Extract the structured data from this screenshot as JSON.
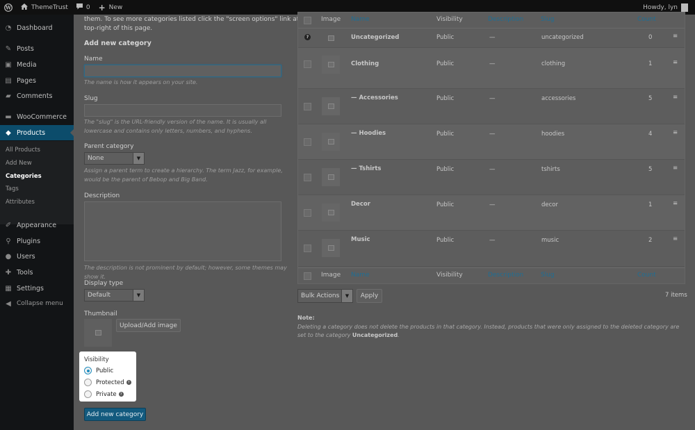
{
  "adminbar": {
    "site_name": "ThemeTrust",
    "comments_count": "0",
    "new_label": "New",
    "howdy": "Howdy, lyn"
  },
  "sidebar": {
    "items": [
      {
        "label": "Dashboard",
        "icon": "dashboard-icon"
      },
      {
        "label": "Posts",
        "icon": "pin-icon"
      },
      {
        "label": "Media",
        "icon": "media-icon"
      },
      {
        "label": "Pages",
        "icon": "pages-icon"
      },
      {
        "label": "Comments",
        "icon": "comment-icon"
      },
      {
        "label": "WooCommerce",
        "icon": "woocommerce-icon"
      },
      {
        "label": "Products",
        "icon": "products-icon"
      },
      {
        "label": "Appearance",
        "icon": "brush-icon"
      },
      {
        "label": "Plugins",
        "icon": "plug-icon"
      },
      {
        "label": "Users",
        "icon": "users-icon"
      },
      {
        "label": "Tools",
        "icon": "wrench-icon"
      },
      {
        "label": "Settings",
        "icon": "settings-icon"
      },
      {
        "label": "Collapse menu",
        "icon": "collapse-icon"
      }
    ],
    "submenu": [
      "All Products",
      "Add New",
      "Categories",
      "Tags",
      "Attributes"
    ]
  },
  "form": {
    "intro_line1": "them. To see more categories listed click the \"screen options\" link at the",
    "intro_line2": "top-right of this page.",
    "heading": "Add new category",
    "name_label": "Name",
    "name_help": "The name is how it appears on your site.",
    "slug_label": "Slug",
    "slug_help": "The \"slug\" is the URL-friendly version of the name. It is usually all lowercase and contains only letters, numbers, and hyphens.",
    "parent_label": "Parent category",
    "parent_value": "None",
    "parent_help": "Assign a parent term to create a hierarchy. The term Jazz, for example, would be the parent of Bebop and Big Band.",
    "description_label": "Description",
    "description_help": "The description is not prominent by default; however, some themes may show it.",
    "display_type_label": "Display type",
    "display_type_value": "Default",
    "thumbnail_label": "Thumbnail",
    "upload_button": "Upload/Add image",
    "visibility_label": "Visibility",
    "visibility_options": [
      "Public",
      "Protected",
      "Private"
    ],
    "visibility_selected": "Public",
    "submit_button": "Add new category"
  },
  "table": {
    "columns": [
      "Image",
      "Name",
      "Visibility",
      "Description",
      "Slug",
      "Count"
    ],
    "rows": [
      {
        "name": "Uncategorized",
        "visibility": "Public",
        "description": "—",
        "slug": "uncategorized",
        "count": "0"
      },
      {
        "name": "Clothing",
        "visibility": "Public",
        "description": "—",
        "slug": "clothing",
        "count": "1"
      },
      {
        "name": "— Accessories",
        "visibility": "Public",
        "description": "—",
        "slug": "accessories",
        "count": "5"
      },
      {
        "name": "— Hoodies",
        "visibility": "Public",
        "description": "—",
        "slug": "hoodies",
        "count": "4"
      },
      {
        "name": "— Tshirts",
        "visibility": "Public",
        "description": "—",
        "slug": "tshirts",
        "count": "5"
      },
      {
        "name": "Decor",
        "visibility": "Public",
        "description": "—",
        "slug": "decor",
        "count": "1"
      },
      {
        "name": "Music",
        "visibility": "Public",
        "description": "—",
        "slug": "music",
        "count": "2"
      }
    ],
    "bulk_actions": "Bulk Actions",
    "apply_button": "Apply",
    "items_count": "7 items",
    "note_title": "Note:",
    "note_text": "Deleting a category does not delete the products in that category. Instead, products that were only assigned to the deleted category are set to the category",
    "note_category": "Uncategorized",
    "note_end": "."
  }
}
